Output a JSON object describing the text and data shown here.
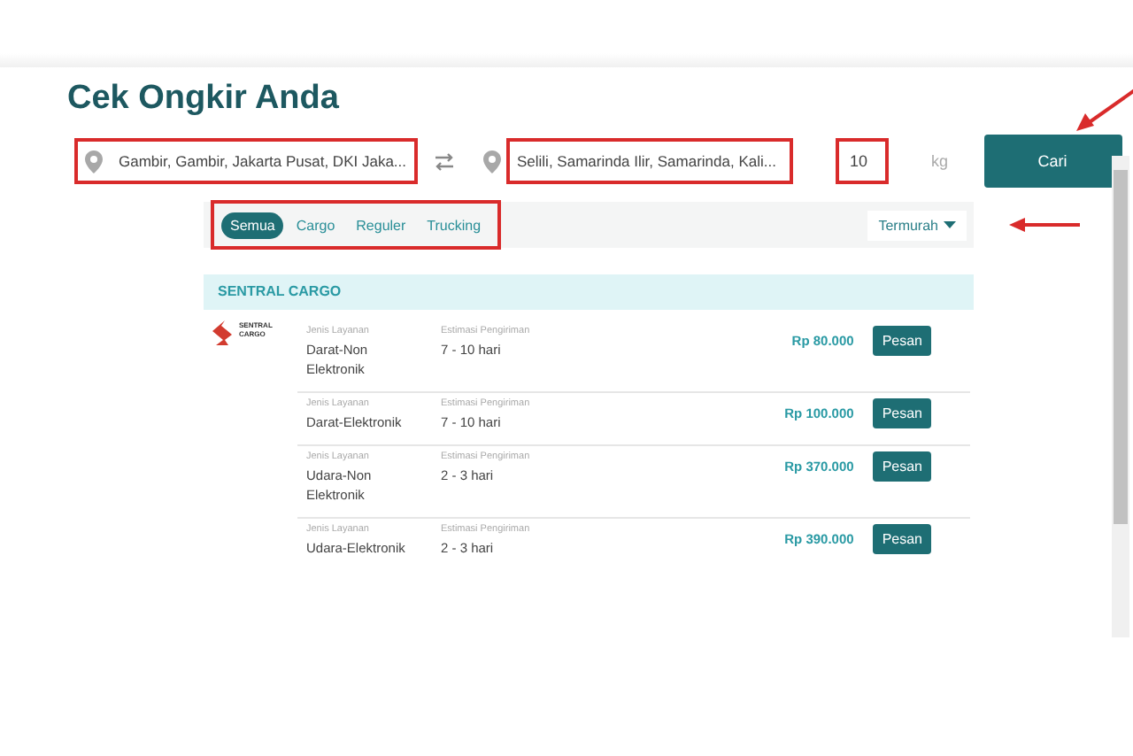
{
  "title": "Cek Ongkir Anda",
  "search": {
    "origin": {
      "value": "Gambir, Gambir, Jakarta Pusat, DKI Jaka...",
      "highlighted": true
    },
    "destination": {
      "value": "Selili, Samarinda Ilir, Samarinda, Kali...",
      "highlighted": true
    },
    "weight": {
      "value": "10",
      "unit": "kg",
      "highlighted": true
    },
    "button": {
      "label": "Cari",
      "arrow_pointer": true
    }
  },
  "filters": {
    "highlighted": true,
    "tabs": [
      {
        "label": "Semua",
        "selected": true
      },
      {
        "label": "Cargo",
        "selected": false
      },
      {
        "label": "Reguler",
        "selected": false
      },
      {
        "label": "Trucking",
        "selected": false
      }
    ],
    "sort": {
      "label": "Termurah",
      "arrow_pointer": true
    }
  },
  "carrier": {
    "name": "SENTRAL CARGO",
    "logo_text": "SENTRAL CARGO",
    "services": [
      {
        "service_label": "Jenis Layanan",
        "service": "Darat-Non Elektronik",
        "estimate_label": "Estimasi Pengiriman",
        "estimate": "7 - 10 hari",
        "price": "Rp 80.000",
        "button": "Pesan"
      },
      {
        "service_label": "Jenis Layanan",
        "service": "Darat-Elektronik",
        "estimate_label": "Estimasi Pengiriman",
        "estimate": "7 - 10 hari",
        "price": "Rp 100.000",
        "button": "Pesan"
      },
      {
        "service_label": "Jenis Layanan",
        "service": "Udara-Non Elektronik",
        "estimate_label": "Estimasi Pengiriman",
        "estimate": "2 - 3 hari",
        "price": "Rp 370.000",
        "button": "Pesan"
      },
      {
        "service_label": "Jenis Layanan",
        "service": "Udara-Elektronik",
        "estimate_label": "Estimasi Pengiriman",
        "estimate": "2 - 3 hari",
        "price": "Rp 390.000",
        "button": "Pesan"
      }
    ]
  }
}
